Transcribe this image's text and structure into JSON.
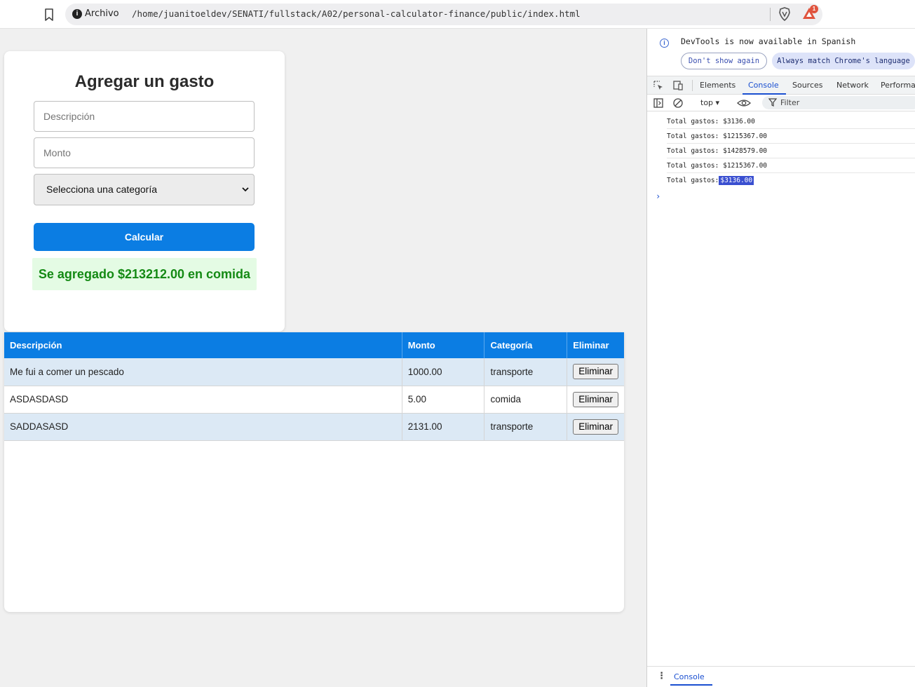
{
  "browser": {
    "scheme_label": "Archivo",
    "url": "/home/juanitoeldev/SENATI/fullstack/A02/personal-calculator-finance/public/index.html",
    "rewards_badge": "1"
  },
  "form": {
    "title": "Agregar un gasto",
    "description_placeholder": "Descripción",
    "amount_placeholder": "Monto",
    "category_selected": "Selecciona una categoría",
    "submit_label": "Calcular",
    "message": "Se agregado $213212.00 en comida",
    "message_color": "#148a14",
    "accent_color": "#0b7de3"
  },
  "table": {
    "headers": [
      "Descripción",
      "Monto",
      "Categoría",
      "Eliminar"
    ],
    "rows": [
      {
        "description": "Me fui a comer un pescado",
        "amount": "1000.00",
        "category": "transporte",
        "action": "Eliminar"
      },
      {
        "description": "ASDASDASD",
        "amount": "5.00",
        "category": "comida",
        "action": "Eliminar"
      },
      {
        "description": "SADDASASD",
        "amount": "2131.00",
        "category": "transporte",
        "action": "Eliminar"
      }
    ]
  },
  "devtools": {
    "banner": "DevTools is now available in Spanish",
    "dont_show": "Don't show again",
    "match_language": "Always match Chrome's language",
    "tabs": [
      "Elements",
      "Console",
      "Sources",
      "Network",
      "Performance"
    ],
    "active_tab": "Console",
    "context": "top",
    "filter_placeholder": "Filter",
    "logs": [
      {
        "prefix": "Total gastos:",
        "value": "$3136.00"
      },
      {
        "prefix": "Total gastos:",
        "value": "$1215367.00"
      },
      {
        "prefix": "Total gastos:",
        "value": "$1428579.00"
      },
      {
        "prefix": "Total gastos:",
        "value": "$1215367.00"
      },
      {
        "prefix": "Total gastos:",
        "value": "$3136.00"
      }
    ],
    "prompt": "›",
    "drawer_tab": "Console"
  }
}
